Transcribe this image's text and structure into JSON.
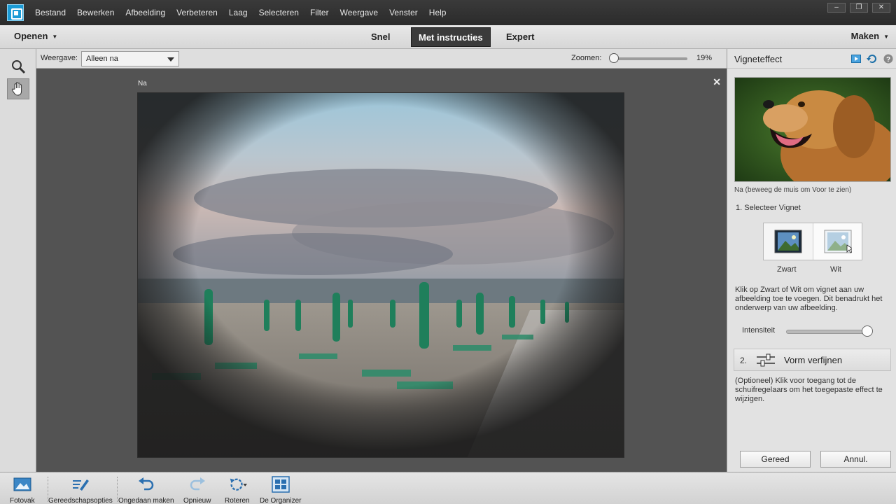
{
  "menu": [
    "Bestand",
    "Bewerken",
    "Afbeelding",
    "Verbeteren",
    "Laag",
    "Selecteren",
    "Filter",
    "Weergave",
    "Venster",
    "Help"
  ],
  "window_controls": [
    "–",
    "❐",
    "✕"
  ],
  "modebar": {
    "open_label": "Openen",
    "tabs": [
      "Snel",
      "Met instructies",
      "Expert"
    ],
    "active_tab": "Met instructies",
    "make_label": "Maken"
  },
  "options": {
    "view_label": "Weergave:",
    "view_value": "Alleen na",
    "zoom_label": "Zoomen:",
    "zoom_value": "19%",
    "zoom_level": 0.0
  },
  "canvas": {
    "label": "Na",
    "close": "✕"
  },
  "panel": {
    "title": "Vigneteffect",
    "preview_caption": "Na (beweeg de muis om Voor te zien)",
    "step1": "1. Selecteer Vignet",
    "vignet_options": [
      "Zwart",
      "Wit"
    ],
    "selected_vignet": "Wit",
    "step1_desc": "Klik op Zwart of Wit om vignet aan uw afbeelding toe te voegen. Dit benadrukt het onderwerp van uw afbeelding.",
    "intensity_label": "Intensiteit",
    "intensity_level": 0.95,
    "step2_num": "2.",
    "step2_label": "Vorm verfijnen",
    "step2_desc": "(Optioneel) Klik voor toegang tot de schuifregelaars om het toegepaste effect te wijzigen.",
    "done_button": "Gereed",
    "cancel_button": "Annul."
  },
  "bottombar": {
    "items": [
      "Fotovak",
      "Gereedschapsopties",
      "Ongedaan maken",
      "Opnieuw",
      "Roteren",
      "De Organizer"
    ]
  },
  "colors": {
    "accent": "#1b9bd6",
    "active_tab_bg": "#3b3b3b",
    "workspace": "#535353"
  }
}
